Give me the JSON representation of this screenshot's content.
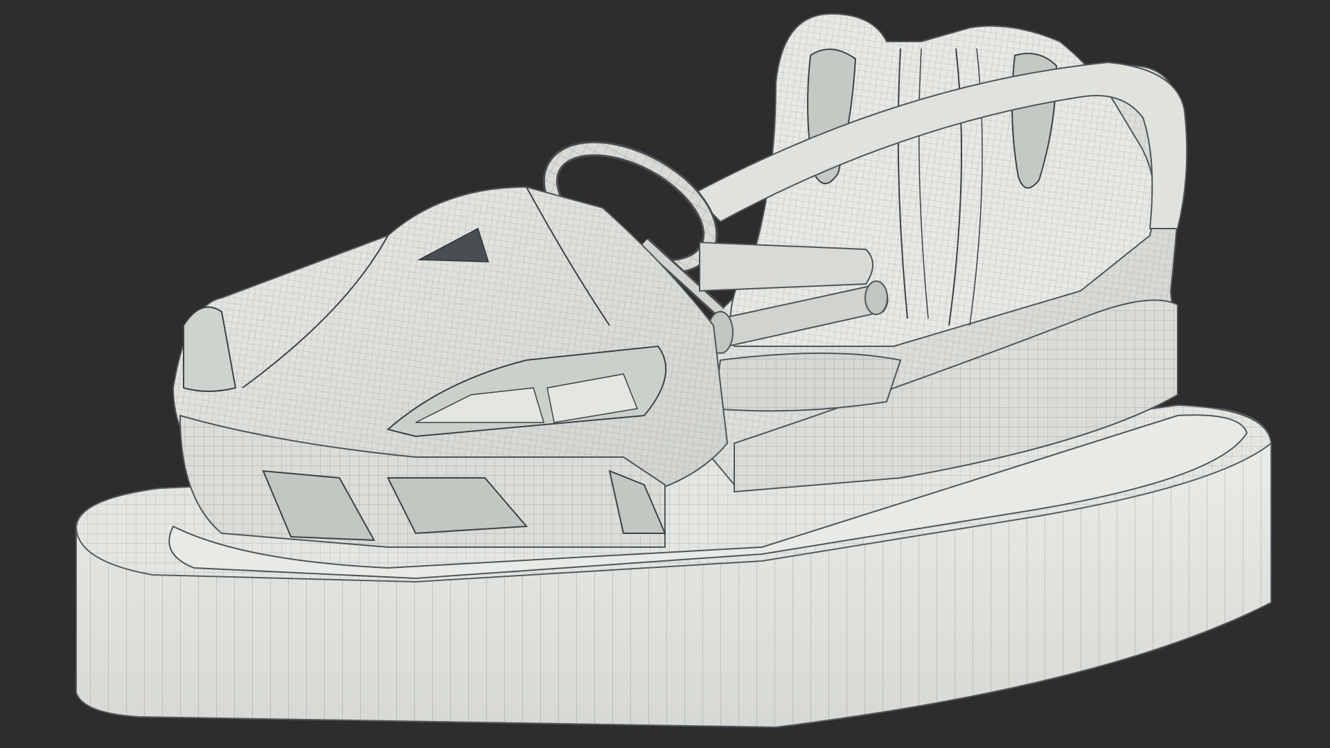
{
  "scene": {
    "subject": "bumper-car-wireframe-model",
    "colors": {
      "background": "#2d2d2d",
      "surface": "#e4e6e2",
      "surface_shade": "#c8cbc6",
      "surface_dark": "#a9ada8",
      "wire": "#3a3d40",
      "glass": "#d9dcd8"
    }
  }
}
